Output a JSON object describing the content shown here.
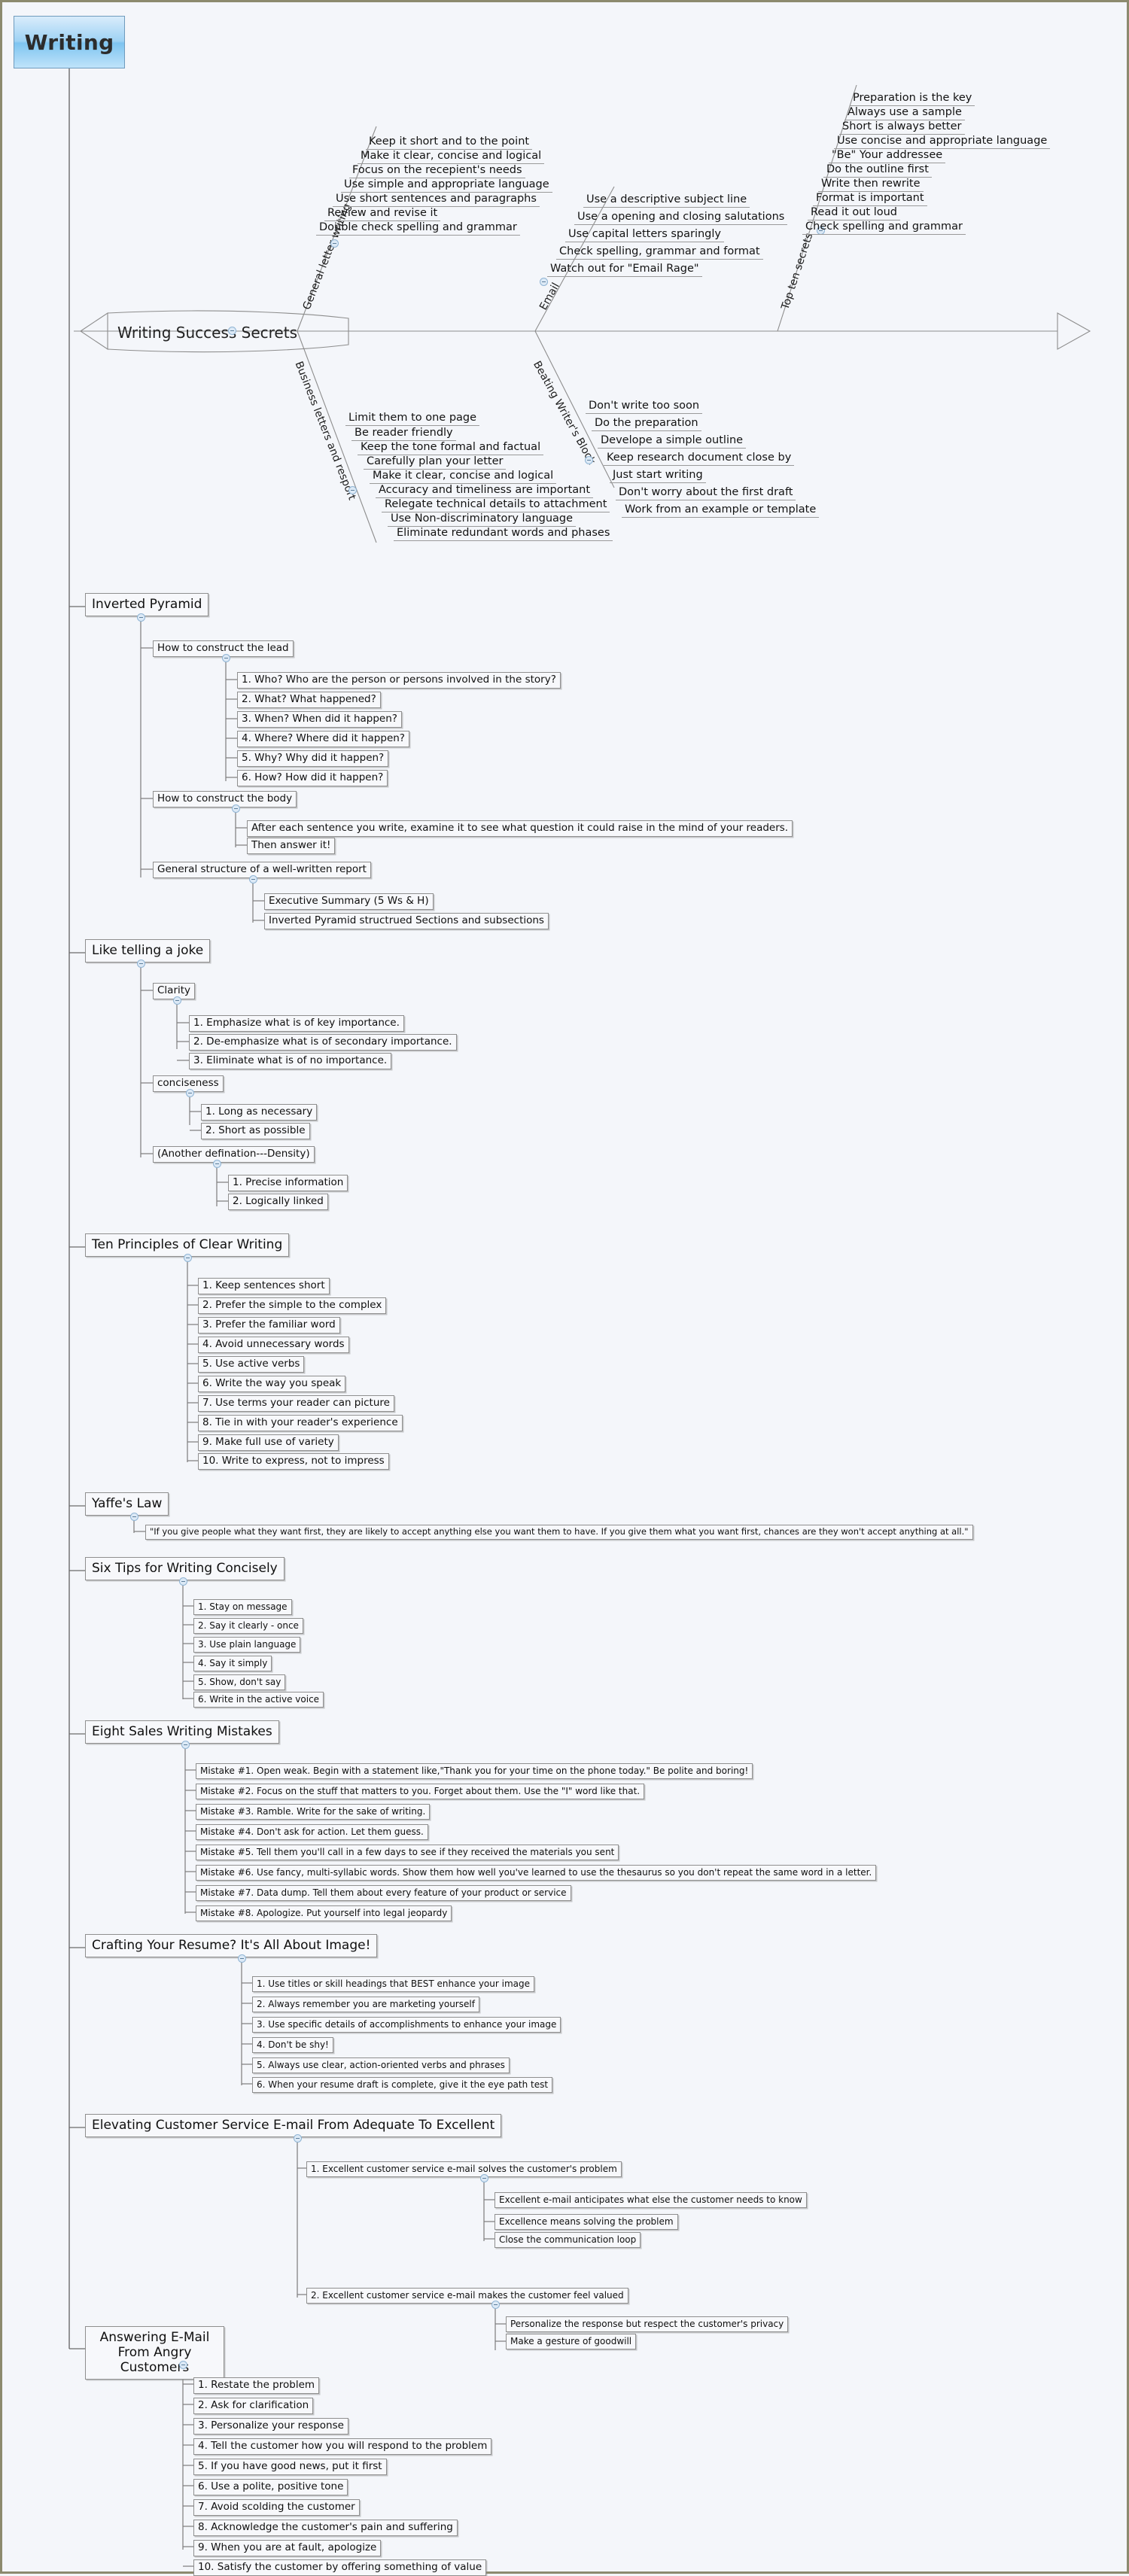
{
  "root": {
    "label": "Writing"
  },
  "fishbone": {
    "head": "Writing Success Secrets",
    "branches": [
      {
        "label": "General letter writing",
        "side": "top",
        "items": [
          "Keep it short and to the point",
          "Make it clear, concise and logical",
          "Focus on the recepient's needs",
          "Use simple and appropriate language",
          "Use short sentences and paragraphs",
          "Review and revise it",
          "Double check spelling and grammar"
        ]
      },
      {
        "label": "Email",
        "side": "top",
        "items": [
          "Use a descriptive subject line",
          "Use a opening and closing salutations",
          "Use capital letters sparingly",
          "Check spelling, grammar and format",
          "Watch out for \"Email Rage\""
        ]
      },
      {
        "label": "Top ten secrets",
        "side": "top",
        "items": [
          "Preparation is the key",
          "Always use a sample",
          "Short is always better",
          "Use concise and appropriate language",
          "\"Be\" Your addressee",
          "Do the outline first",
          "Write then rewrite",
          "Format is important",
          "Read it out loud",
          "Check spelling and grammar"
        ]
      },
      {
        "label": "Business letters and resport",
        "side": "bottom",
        "items": [
          "Limit them to one page",
          "Be reader friendly",
          "Keep the tone formal and factual",
          "Carefully plan your letter",
          "Make it clear, concise and logical",
          "Accuracy and timeliness are important",
          "Relegate technical details to attachment",
          "Use Non-discriminatory language",
          "Eliminate redundant words and phases"
        ]
      },
      {
        "label": "Beating Writer's Block",
        "side": "bottom",
        "items": [
          "Don't write too soon",
          "Do the preparation",
          "Develope a simple outline",
          "Keep research document close by",
          "Just start writing",
          "Don't worry about the first draft",
          "Work from an example or template"
        ]
      }
    ]
  },
  "sections": {
    "inverted_pyramid": {
      "label": "Inverted Pyramid",
      "children": [
        {
          "label": "How to construct the lead",
          "children": [
            "1. Who? Who are the person or persons involved in the story?",
            "2. What? What happened?",
            "3. When? When did it happen?",
            "4. Where? Where did it happen?",
            "5. Why? Why did it happen?",
            "6. How? How did it happen?"
          ]
        },
        {
          "label": "How to construct the body",
          "children": [
            "After each sentence you write, examine it to see what question it could raise in the mind of your readers.",
            "Then answer it!"
          ]
        },
        {
          "label": "General structure of a well-written report",
          "children": [
            "Executive Summary (5 Ws & H)",
            "Inverted Pyramid structrued Sections and subsections"
          ]
        }
      ]
    },
    "like_telling_a_joke": {
      "label": "Like telling a joke",
      "children": [
        {
          "label": "Clarity",
          "children": [
            "1. Emphasize what is of key importance.",
            "2. De-emphasize what is of secondary importance.",
            "3. Eliminate what is of no importance."
          ]
        },
        {
          "label": "conciseness",
          "children": [
            "1. Long as necessary",
            "2. Short as possible"
          ]
        },
        {
          "label": "(Another defination---Density)",
          "children": [
            "1. Precise information",
            "2. Logically linked"
          ]
        }
      ]
    },
    "ten_principles": {
      "label": "Ten Principles of Clear Writing",
      "children": [
        "1. Keep sentences short",
        "2. Prefer the simple to the complex",
        "3. Prefer the familiar word",
        "4. Avoid unnecessary words",
        "5. Use active verbs",
        "6. Write the way you speak",
        "7. Use terms your reader can picture",
        "8. Tie in with your reader's experience",
        "9. Make full use of variety",
        "10. Write to express, not to impress"
      ]
    },
    "yaffes_law": {
      "label": "Yaffe's Law",
      "children": [
        "\"If you give people what they want first, they are likely to accept anything else you want them to have. If you give them what you want first, chances are they won't accept anything at all.\""
      ]
    },
    "six_tips": {
      "label": "Six Tips for Writing Concisely",
      "children": [
        "1. Stay on message",
        "2. Say it clearly - once",
        "3. Use plain language",
        "4. Say it simply",
        "5. Show, don't say",
        "6. Write in the active voice"
      ]
    },
    "eight_mistakes": {
      "label": "Eight Sales Writing Mistakes",
      "children": [
        "Mistake #1. Open weak. Begin with a statement like,\"Thank you for your time on the phone today.\" Be polite and boring!",
        "Mistake #2. Focus on the stuff that matters to you. Forget about them. Use the \"I\" word like that.",
        "Mistake #3. Ramble. Write for the sake of writing.",
        "Mistake #4. Don't ask for action. Let them guess.",
        "Mistake #5. Tell them you'll call in a few days to see if they received the materials you sent",
        "Mistake #6. Use fancy, multi-syllabic words. Show them how well you've learned to use the thesaurus so you don't repeat the same word in a letter.",
        "Mistake #7. Data dump. Tell them about every feature of your product or service",
        "Mistake #8. Apologize. Put yourself into legal jeopardy"
      ]
    },
    "resume": {
      "label": "Crafting Your Resume? It's All About Image!",
      "children": [
        "1. Use titles or skill headings that BEST enhance your image",
        "2. Always remember you are marketing yourself",
        "3. Use specific details of accomplishments to enhance your image",
        "4. Don't be shy!",
        "5. Always use clear, action-oriented verbs and phrases",
        "6. When your resume draft is complete, give it the eye path test"
      ]
    },
    "customer_service": {
      "label": "Elevating Customer Service E-mail From Adequate To Excellent",
      "children": [
        {
          "label": "1. Excellent customer service e-mail solves the customer's problem",
          "children": [
            "Excellent e-mail anticipates what else the customer needs to know",
            "Excellence means solving the problem",
            "Close the communication loop"
          ]
        },
        {
          "label": "2. Excellent customer service e-mail makes the customer feel valued",
          "children": [
            "Personalize the response but respect the customer's privacy",
            "Make a gesture of goodwill"
          ]
        }
      ]
    },
    "angry_customers": {
      "label": "Answering E-Mail\nFrom Angry Customers",
      "children": [
        "1. Restate the problem",
        "2. Ask for clarification",
        "3. Personalize your response",
        "4. Tell the customer how you will respond to the problem",
        "5. If you have good news, put it first",
        "6. Use a polite, positive tone",
        "7. Avoid scolding the customer",
        "8. Acknowledge the customer's pain and suffering",
        "9. When you are at fault, apologize",
        "10. Satisfy the customer by offering something of value"
      ]
    }
  }
}
